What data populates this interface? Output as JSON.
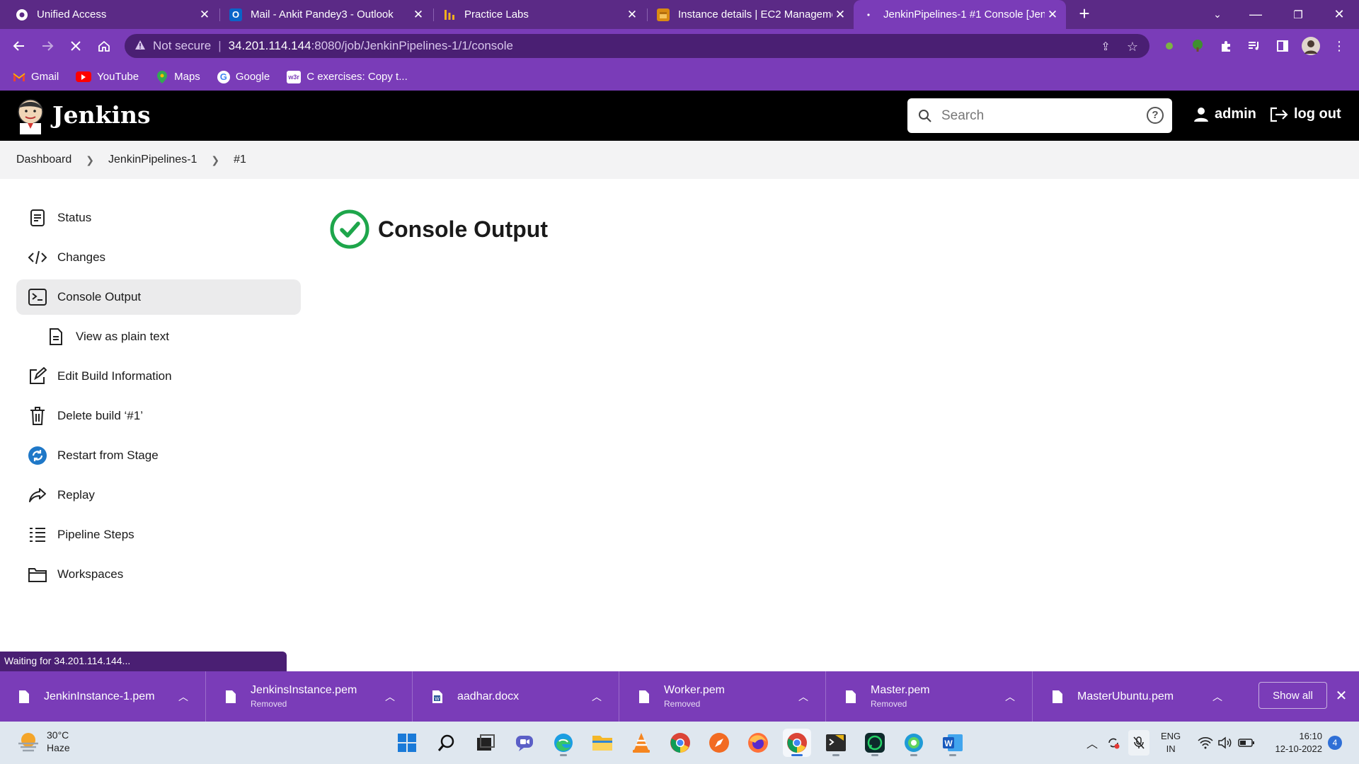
{
  "browser": {
    "tabs": [
      {
        "title": "Unified Access",
        "icon": "globe-icon"
      },
      {
        "title": "Mail - Ankit Pandey3 - Outlook",
        "icon": "outlook-icon"
      },
      {
        "title": "Practice Labs",
        "icon": "practice-labs-icon"
      },
      {
        "title": "Instance details | EC2 Manageme",
        "icon": "aws-icon"
      },
      {
        "title": "JenkinPipelines-1 #1 Console [Jen",
        "icon": "loading-icon",
        "active": true
      }
    ],
    "address": {
      "security_label": "Not secure",
      "host": "34.201.114.144",
      "path": ":8080/job/JenkinPipelines-1/1/console"
    },
    "bookmarks": [
      {
        "label": "Gmail",
        "icon": "gmail-icon"
      },
      {
        "label": "YouTube",
        "icon": "youtube-icon"
      },
      {
        "label": "Maps",
        "icon": "maps-icon"
      },
      {
        "label": "Google",
        "icon": "google-icon"
      },
      {
        "label": "C exercises: Copy t...",
        "icon": "w3r-icon"
      }
    ],
    "status_bubble": "Waiting for 34.201.114.144..."
  },
  "jenkins": {
    "brand": "Jenkins",
    "search_placeholder": "Search",
    "user": "admin",
    "logout_label": "log out",
    "breadcrumbs": [
      "Dashboard",
      "JenkinPipelines-1",
      "#1"
    ],
    "side_panel": [
      {
        "label": "Status",
        "icon": "status-icon"
      },
      {
        "label": "Changes",
        "icon": "code-icon"
      },
      {
        "label": "Console Output",
        "icon": "terminal-icon",
        "active": true
      },
      {
        "label": "View as plain text",
        "icon": "document-icon",
        "sub": true
      },
      {
        "label": "Edit Build Information",
        "icon": "edit-icon"
      },
      {
        "label": "Delete build ‘#1’",
        "icon": "trash-icon"
      },
      {
        "label": "Restart from Stage",
        "icon": "restart-icon"
      },
      {
        "label": "Replay",
        "icon": "replay-icon"
      },
      {
        "label": "Pipeline Steps",
        "icon": "list-icon"
      },
      {
        "label": "Workspaces",
        "icon": "folder-icon"
      }
    ],
    "page_title": "Console Output",
    "status_color": "#1ea64b"
  },
  "downloads": {
    "items": [
      {
        "name": "JenkinInstance-1.pem",
        "status": ""
      },
      {
        "name": "JenkinsInstance.pem",
        "status": "Removed"
      },
      {
        "name": "aadhar.docx",
        "status": ""
      },
      {
        "name": "Worker.pem",
        "status": "Removed"
      },
      {
        "name": "Master.pem",
        "status": "Removed"
      },
      {
        "name": "MasterUbuntu.pem",
        "status": ""
      }
    ],
    "show_all_label": "Show all"
  },
  "taskbar": {
    "weather": {
      "temp": "30°C",
      "condition": "Haze"
    },
    "language": {
      "line1": "ENG",
      "line2": "IN"
    },
    "time": "16:10",
    "date": "12-10-2022",
    "notification_count": "4"
  },
  "colors": {
    "browser_frame": "#5b2a86",
    "browser_toolbar": "#7a3cb8",
    "jenkins_header": "#000000",
    "success": "#1ea64b"
  }
}
